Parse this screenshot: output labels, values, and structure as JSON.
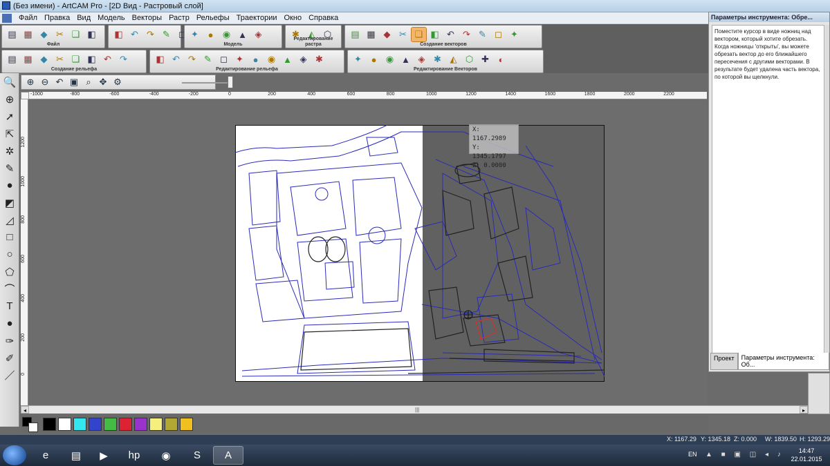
{
  "window": {
    "title": "(Без имени) - ArtCAM Pro - [2D Вид - Растровый слой]"
  },
  "menu": [
    "Файл",
    "Правка",
    "Вид",
    "Модель",
    "Векторы",
    "Растр",
    "Рельефы",
    "Траектории",
    "Окно",
    "Справка"
  ],
  "toolbars": {
    "row1": [
      {
        "caption": "Файл",
        "icons": [
          "new-file-icon",
          "open-folder-icon",
          "save-icon",
          "cut-icon",
          "copy-icon",
          "paste-icon"
        ]
      },
      {
        "caption": "",
        "icons": [
          "undo-icon",
          "redo-icon",
          "pencil-icon",
          "eraser-icon",
          "bulb-icon"
        ]
      },
      {
        "caption": "Модель",
        "icons": [
          "model-icon",
          "bear-icon",
          "relief-icon",
          "hat-icon",
          "globe-icon"
        ]
      },
      {
        "caption": "Редактирование растра",
        "icons": [
          "raster-icon",
          "diamond-icon",
          "wand-icon"
        ]
      },
      {
        "caption": "Создание векторов",
        "icons": [
          "node-icon",
          "node-edit-icon",
          "curve-icon",
          "bracket-icon",
          "scissors-icon",
          "knife-icon",
          "fill-icon",
          "vector-icon",
          "nesting-icon",
          "grid-icon",
          "layers-icon"
        ]
      }
    ],
    "row2": [
      {
        "caption": "Создание рельефа",
        "icons": [
          "shape-icon",
          "twist-icon",
          "star-icon",
          "extrude-icon",
          "spin-icon",
          "texture-icon",
          "mold-icon",
          "gold-icon"
        ]
      },
      {
        "caption": "Редактирование рельефа",
        "icons": [
          "flat-icon",
          "arrow-up-icon",
          "arrow-down-icon",
          "scatter-icon",
          "smooth-icon",
          "arch-icon",
          "column-icon",
          "blend-icon",
          "diamond-edit-icon",
          "color-icon",
          "brush-icon"
        ]
      },
      {
        "caption": "Редактирование Векторов",
        "icons": [
          "plus-icon",
          "bowl-icon",
          "mirror-icon",
          "wave-icon",
          "spiral-icon",
          "combine-icon",
          "offset-icon",
          "join-icon",
          "trim-icon",
          "transform-icon"
        ]
      }
    ]
  },
  "scissors_active": true,
  "ruler": {
    "top_labels": [
      "-1000",
      "-800",
      "-600",
      "-400",
      "-200",
      "0",
      "200",
      "400",
      "600",
      "800",
      "1000",
      "1200",
      "1400",
      "1600",
      "1800",
      "2000",
      "2200"
    ],
    "left_labels": [
      "1200",
      "1000",
      "800",
      "600",
      "400",
      "200",
      "0"
    ]
  },
  "coord_tip": {
    "x": "X: 1167.2989",
    "y": "Y: 1345.1797",
    "z": "Z: 0.0000"
  },
  "panel": {
    "header": "Параметры инструмента: Обре...",
    "text": "Поместите курсор в виде ножниц над вектором, который хотите обрезать. Когда ножницы 'открыты', вы можете обрезать вектор до его ближайшего пересечения с другими векторами. В результате будет удалена часть вектора, по которой вы щелкнули.",
    "tabs": [
      "Проект",
      "Параметры инструмента: Об..."
    ]
  },
  "palette": {
    "primary": "#000000",
    "secondary": "#ffffff",
    "swatches": [
      "#000000",
      "#ffffff",
      "#33e6f0",
      "#3344cc",
      "#44bb44",
      "#dd2233",
      "#9933cc",
      "#f5ef80",
      "#b3a733",
      "#f0c020"
    ]
  },
  "statusbar": {
    "x": "X: 1167.29",
    "y": "Y: 1345.18",
    "z": "Z: 0.000",
    "w": "W: 1839.50",
    "h": "H: 1293.29"
  },
  "taskbar": {
    "lang": "EN",
    "time": "14:47",
    "date": "22.01.2015",
    "apps": [
      "ie-icon",
      "explorer-icon",
      "media-player-icon",
      "hp-icon",
      "chrome-icon",
      "skype-icon",
      "artcam-icon"
    ]
  }
}
